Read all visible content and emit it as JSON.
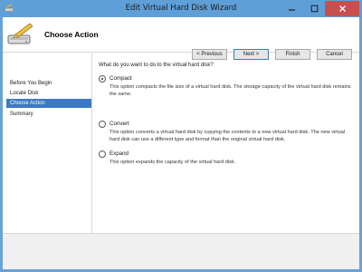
{
  "window": {
    "title": "Edit Virtual Hard Disk Wizard",
    "accent": "#5f9fd8",
    "close_color": "#c7504f",
    "icon": "disk-pencil-icon"
  },
  "header": {
    "title": "Choose Action",
    "icon": "disk-pencil-icon"
  },
  "sidebar": {
    "items": [
      {
        "label": "Before You Begin",
        "selected": false
      },
      {
        "label": "Locate Disk",
        "selected": false
      },
      {
        "label": "Choose Action",
        "selected": true
      },
      {
        "label": "Summary",
        "selected": false
      }
    ],
    "selected_color": "#3c78c6"
  },
  "main": {
    "question": "What do you want to do to the virtual hard disk?",
    "options": [
      {
        "label": "Compact",
        "selected": true,
        "description": "This option compacts the file size of a virtual hard disk. The storage capacity of the virtual hard disk remains the same."
      },
      {
        "label": "Convert",
        "selected": false,
        "description": "This option converts a virtual hard disk by copying the contents to a new virtual hard disk. The new virtual hard disk can use a different type and format than the original virtual hard disk."
      },
      {
        "label": "Expand",
        "selected": false,
        "description": "This option expands the capacity of the virtual hard disk."
      }
    ]
  },
  "footer": {
    "previous_label": "< Previous",
    "next_label": "Next >",
    "finish_label": "Finish",
    "cancel_label": "Cancel"
  }
}
